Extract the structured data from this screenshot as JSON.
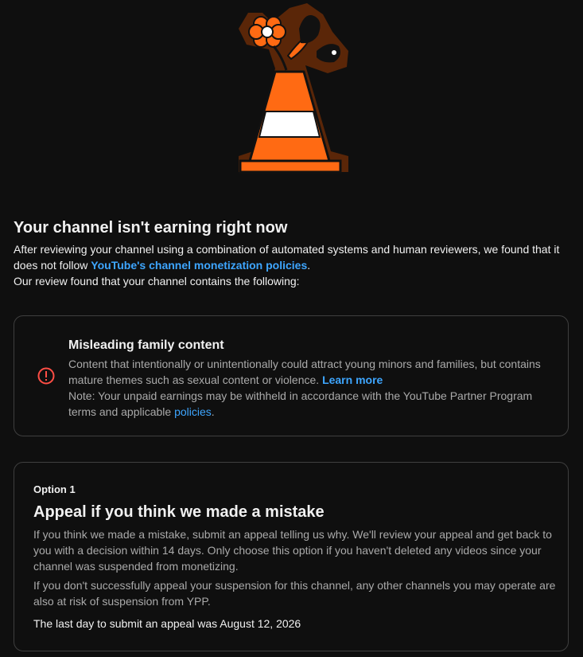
{
  "header": {
    "title": "Your channel isn't earning right now",
    "intro_before_link": "After reviewing your channel using a combination of automated systems and human reviewers, we found that it does not follow ",
    "intro_link": "YouTube's channel monetization policies",
    "intro_after_link": ".",
    "review_found": "Our review found that your channel contains the following:"
  },
  "violation": {
    "icon": "alert-circle-icon",
    "title": "Misleading family content",
    "description": "Content that intentionally or unintentionally could attract young minors and families, but contains mature themes such as sexual content or violence. ",
    "learn_more": "Learn more",
    "note_prefix": "Note: Your unpaid earnings may be withheld in accordance with the YouTube Partner Program terms and applicable ",
    "policies_link": "policies",
    "note_suffix": "."
  },
  "option": {
    "label": "Option 1",
    "title": "Appeal if you think we made a mistake",
    "paragraph1": "If you think we made a mistake, submit an appeal telling us why. We'll review your appeal and get back to you with a decision within 14 days. Only choose this option if you haven't deleted any videos since your channel was suspended from monetizing.",
    "paragraph2": "If you don't successfully appeal your suspension for this channel, any other channels you may operate are also at risk of suspension from YPP.",
    "deadline": "The last day to submit an appeal was August 12, 2026"
  },
  "colors": {
    "background": "#0f0f0f",
    "link": "#3ea6ff",
    "alert": "#ff4e45",
    "cone_orange": "#ff6a13",
    "cone_outline": "#6b2e0a"
  }
}
